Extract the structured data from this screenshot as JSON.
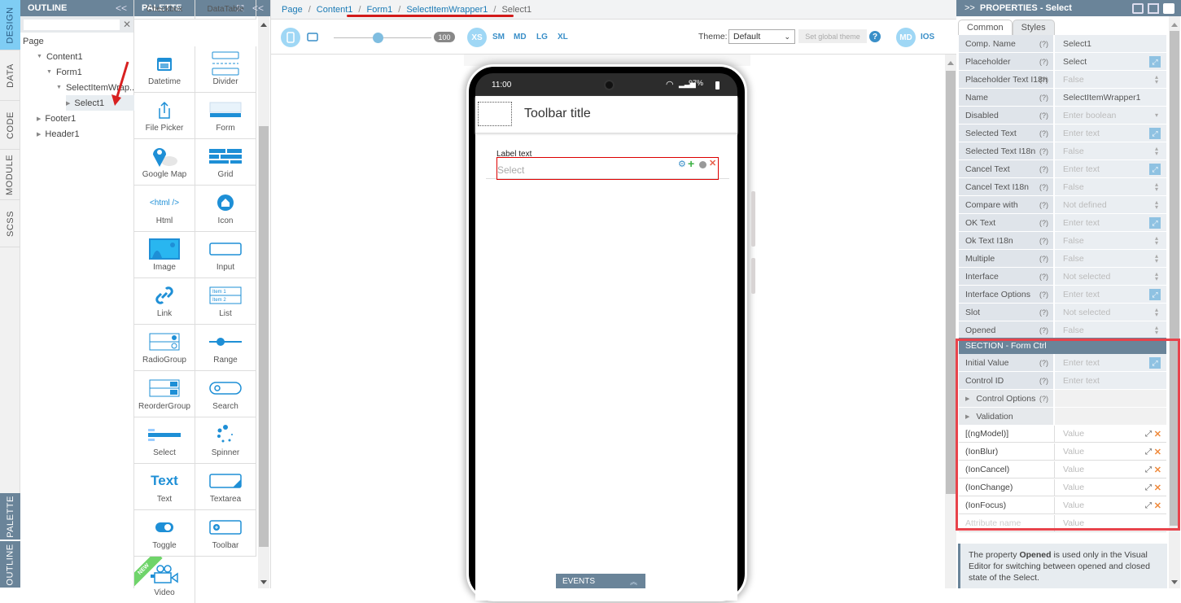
{
  "left_tabs": [
    "DESIGN",
    "DATA",
    "CODE",
    "MODULE",
    "SCSS"
  ],
  "left_bottom_tabs": [
    "PALETTE",
    "OUTLINE"
  ],
  "outline": {
    "title": "OUTLINE",
    "collapse": "<<",
    "search_value": "",
    "tree": [
      {
        "label": "Page",
        "level": 0,
        "toggle": ""
      },
      {
        "label": "Content1",
        "level": 1,
        "toggle": "expanded"
      },
      {
        "label": "Form1",
        "level": 2,
        "toggle": "expanded"
      },
      {
        "label": "SelectItemWrap...",
        "level": 3,
        "toggle": "expanded"
      },
      {
        "label": "Select1",
        "level": 4,
        "toggle": "collapsed",
        "selected": true
      },
      {
        "label": "Footer1",
        "level": 1,
        "toggle": "collapsed"
      },
      {
        "label": "Header1",
        "level": 1,
        "toggle": "collapsed"
      }
    ]
  },
  "palette": {
    "title": "PALETTE",
    "collapse": "<<",
    "items": [
      "Checkbox",
      "DataTable",
      "Datetime",
      "Divider",
      "File Picker",
      "Form",
      "Google Map",
      "Grid",
      "Html",
      "Icon",
      "Image",
      "Input",
      "Link",
      "List",
      "RadioGroup",
      "Range",
      "ReorderGroup",
      "Search",
      "Select",
      "Spinner",
      "Text",
      "Textarea",
      "Toggle",
      "Toolbar",
      "Video"
    ],
    "new_badge": "NEW",
    "html_icon_text": "<html />",
    "text_icon_text": "Text"
  },
  "breadcrumb": [
    "Page",
    "Content1",
    "Form1",
    "SelectItemWrapper1",
    "Select1"
  ],
  "toolbar": {
    "zoom_value": "100",
    "zoom_fraction": 0.45,
    "sizes": [
      "XS",
      "SM",
      "MD",
      "LG",
      "XL"
    ],
    "active_size": "XS",
    "theme_label": "Theme:",
    "theme_value": "Default",
    "set_global_theme": "Set global theme",
    "help": "?",
    "platforms": [
      "MD",
      "IOS"
    ]
  },
  "phone": {
    "time": "11:00",
    "battery": "97%",
    "toolbar_title": "Toolbar title",
    "label_text": "Label text",
    "select_placeholder": "Select"
  },
  "events_bar": {
    "label": "EVENTS"
  },
  "properties": {
    "title": "PROPERTIES - Select",
    "expand": ">>",
    "tabs": [
      "Common",
      "Styles"
    ],
    "rows": [
      {
        "label": "Comp. Name",
        "value": "Select1",
        "set": true,
        "ctl": ""
      },
      {
        "label": "Placeholder",
        "value": "Select",
        "set": true,
        "ctl": "expand"
      },
      {
        "label": "Placeholder Text I18n",
        "value": "False",
        "set": false,
        "ctl": "spin"
      },
      {
        "label": "Name",
        "value": "SelectItemWrapper1",
        "set": true,
        "ctl": ""
      },
      {
        "label": "Disabled",
        "value": "Enter boolean",
        "set": false,
        "ctl": "drop"
      },
      {
        "label": "Selected Text",
        "value": "Enter text",
        "set": false,
        "ctl": "expand"
      },
      {
        "label": "Selected Text I18n",
        "value": "False",
        "set": false,
        "ctl": "spin"
      },
      {
        "label": "Cancel Text",
        "value": "Enter text",
        "set": false,
        "ctl": "expand"
      },
      {
        "label": "Cancel Text I18n",
        "value": "False",
        "set": false,
        "ctl": "spin"
      },
      {
        "label": "Compare with",
        "value": "Not defined",
        "set": false,
        "ctl": "spin"
      },
      {
        "label": "OK Text",
        "value": "Enter text",
        "set": false,
        "ctl": "expand"
      },
      {
        "label": "Ok Text I18n",
        "value": "False",
        "set": false,
        "ctl": "spin"
      },
      {
        "label": "Multiple",
        "value": "False",
        "set": false,
        "ctl": "spin"
      },
      {
        "label": "Interface",
        "value": "Not selected",
        "set": false,
        "ctl": "spin"
      },
      {
        "label": "Interface Options",
        "value": "Enter text",
        "set": false,
        "ctl": "expand"
      },
      {
        "label": "Slot",
        "value": "Not selected",
        "set": false,
        "ctl": "spin"
      },
      {
        "label": "Opened",
        "value": "False",
        "set": false,
        "ctl": "spin"
      }
    ],
    "section_title": "SECTION - Form Ctrl",
    "section_rows": [
      {
        "label": "Initial Value",
        "value": "Enter text",
        "ctl": "expand"
      },
      {
        "label": "Control ID",
        "value": "Enter text",
        "ctl": ""
      }
    ],
    "groups": [
      "Control Options",
      "Validation"
    ],
    "attributes": [
      {
        "name": "[(ngModel)]",
        "value": "Value"
      },
      {
        "name": "(IonBlur)",
        "value": "Value"
      },
      {
        "name": "(IonCancel)",
        "value": "Value"
      },
      {
        "name": "(IonChange)",
        "value": "Value"
      },
      {
        "name": "(IonFocus)",
        "value": "Value"
      }
    ],
    "new_attr_placeholder": "Attribute name",
    "new_value_placeholder": "Value",
    "note_pre": "The property ",
    "note_bold": "Opened",
    "note_post": " is used only in the Visual Editor for switching between opened and closed state of the Select."
  },
  "colors": {
    "accent": "#6a8499",
    "link": "#1a7ab5",
    "highlight": "#e8434b",
    "icon_blue": "#1e8fd6"
  }
}
